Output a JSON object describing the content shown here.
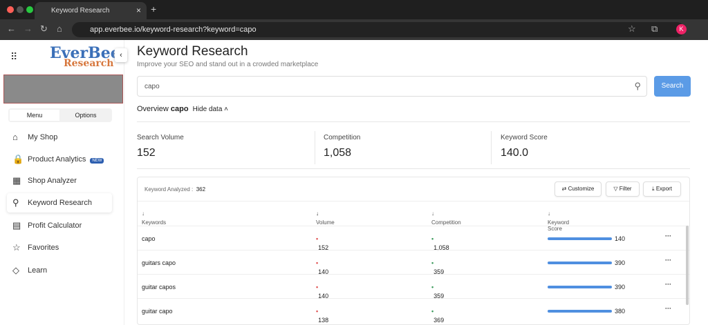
{
  "browser": {
    "tab_title": "Keyword Research",
    "url": "app.everbee.io/keyword-research?keyword=capo",
    "avatar": "K"
  },
  "sidebar": {
    "logo_top": "EverBee",
    "logo_bottom": "Research",
    "seg": [
      "Menu",
      "Options"
    ],
    "items": [
      {
        "label": "My Shop",
        "icon": "⌂"
      },
      {
        "label": "Product Analytics",
        "icon": "🔒",
        "badge": "NEW"
      },
      {
        "label": "Shop Analyzer",
        "icon": "▦"
      },
      {
        "label": "Keyword Research",
        "icon": "⚲"
      },
      {
        "label": "Profit Calculator",
        "icon": "▤"
      },
      {
        "label": "Favorites",
        "icon": "☆"
      },
      {
        "label": "Learn",
        "icon": "◇"
      }
    ]
  },
  "header": {
    "title": "Keyword Research",
    "subtitle": "Improve your SEO and stand out in a crowded marketplace"
  },
  "search": {
    "value": "capo",
    "button": "Search"
  },
  "overview": {
    "label": "Overview",
    "keyword": "capo",
    "toggle": "Hide data"
  },
  "stats": [
    {
      "label": "Search Volume",
      "value": "152"
    },
    {
      "label": "Competition",
      "value": "1,058"
    },
    {
      "label": "Keyword Score",
      "value": "140.0"
    }
  ],
  "table": {
    "analyzed_label": "Keyword Analyzed :",
    "analyzed_count": "362",
    "buttons": [
      "Customize",
      "Filter",
      "Export"
    ],
    "columns": [
      "Keywords",
      "Volume",
      "Competition",
      "Keyword Score"
    ],
    "rows": [
      {
        "kw": "capo",
        "vol": "152",
        "comp": "1,058",
        "score": "140"
      },
      {
        "kw": "guitars capo",
        "vol": "140",
        "comp": "359",
        "score": "390"
      },
      {
        "kw": "guitar capos",
        "vol": "140",
        "comp": "359",
        "score": "390"
      },
      {
        "kw": "guitar capo",
        "vol": "138",
        "comp": "369",
        "score": "380"
      }
    ]
  }
}
